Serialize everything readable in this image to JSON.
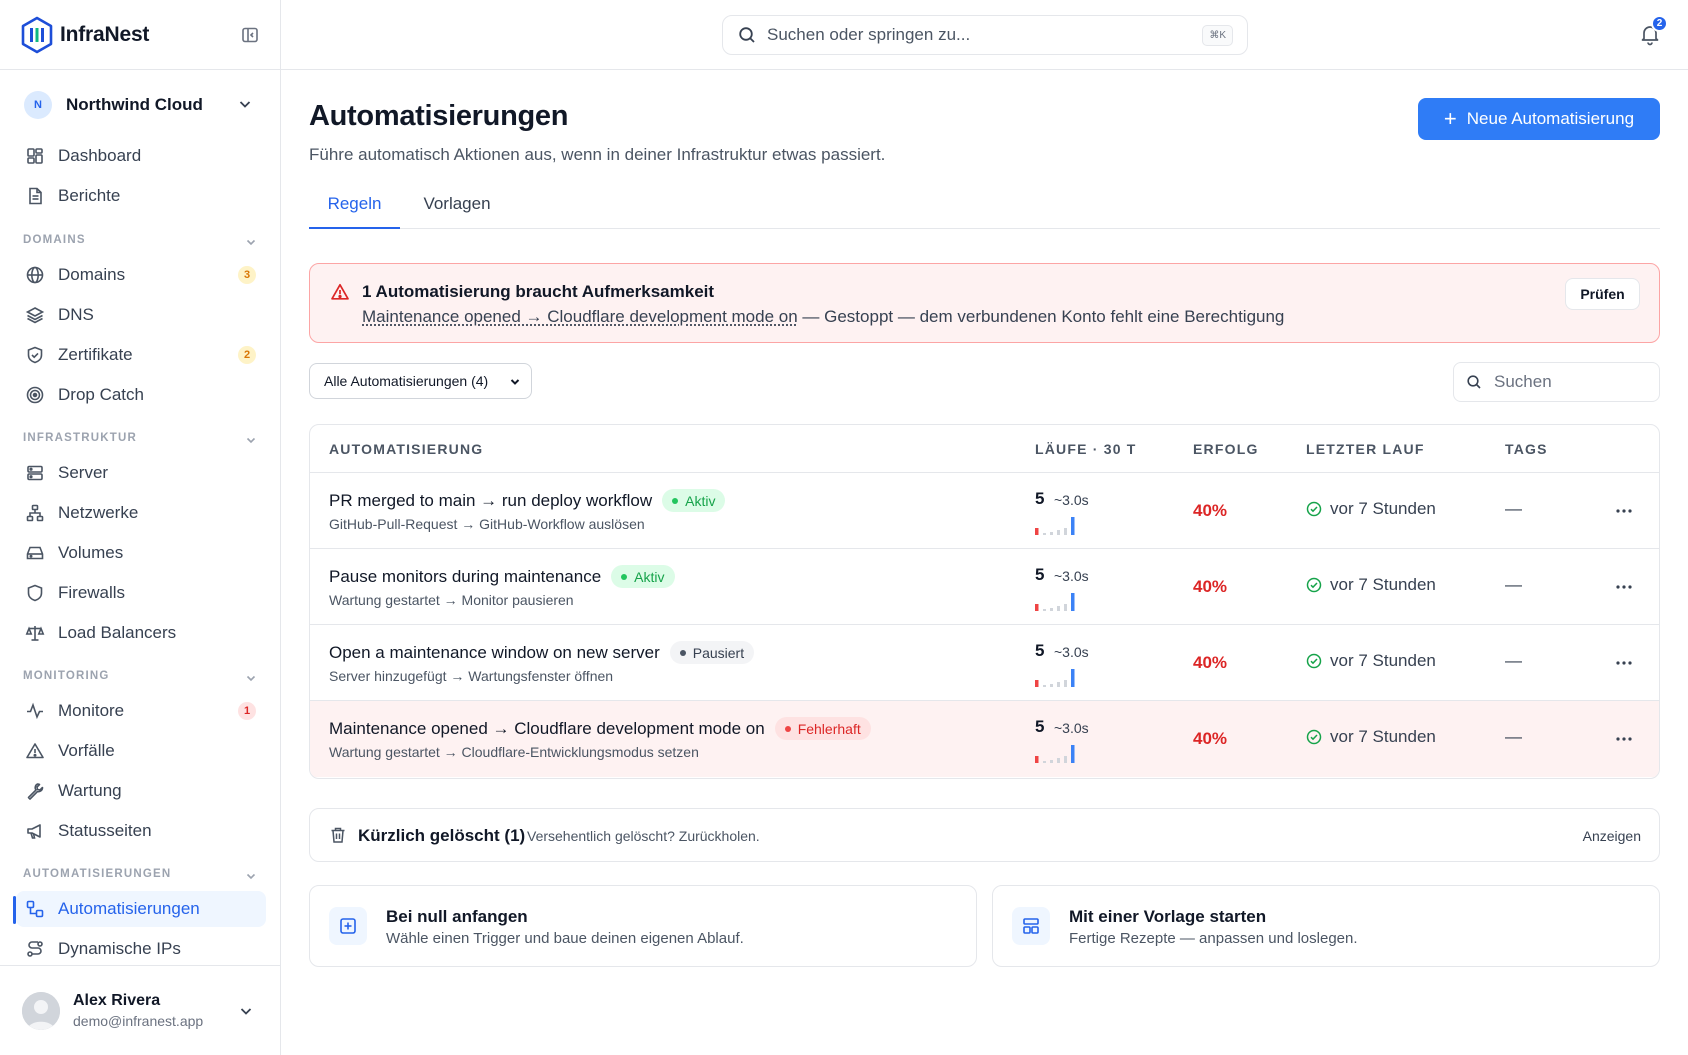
{
  "app": {
    "name": "InfraNest"
  },
  "org": {
    "initial": "N",
    "name": "Northwind Cloud"
  },
  "sidebar": {
    "top_items": [
      {
        "label": "Dashboard"
      },
      {
        "label": "Berichte"
      }
    ],
    "sections": {
      "domains": "DOMAINS",
      "infrastruktur": "INFRASTRUKTUR",
      "monitoring": "MONITORING",
      "automatisierungen": "AUTOMATISIERUNGEN"
    },
    "domains_items": [
      {
        "label": "Domains",
        "count": "3"
      },
      {
        "label": "DNS"
      },
      {
        "label": "Zertifikate",
        "count": "2"
      },
      {
        "label": "Drop Catch"
      }
    ],
    "infra_items": [
      {
        "label": "Server"
      },
      {
        "label": "Netzwerke"
      },
      {
        "label": "Volumes"
      },
      {
        "label": "Firewalls"
      },
      {
        "label": "Load Balancers"
      }
    ],
    "monitoring_items": [
      {
        "label": "Monitore",
        "count": "1"
      },
      {
        "label": "Vorfälle"
      },
      {
        "label": "Wartung"
      },
      {
        "label": "Statusseiten"
      }
    ],
    "automation_items": [
      {
        "label": "Automatisierungen",
        "active": true
      },
      {
        "label": "Dynamische IPs"
      }
    ],
    "user": {
      "name": "Alex Rivera",
      "email": "demo@infranest.app"
    }
  },
  "topbar": {
    "search_placeholder": "Suchen oder springen zu...",
    "shortcut": "⌘K",
    "notification_count": "2"
  },
  "page": {
    "title": "Automatisierungen",
    "subtitle": "Führe automatisch Aktionen aus, wenn in deiner Infrastruktur etwas passiert.",
    "new_button": "Neue Automatisierung",
    "tabs": [
      {
        "label": "Regeln",
        "active": true
      },
      {
        "label": "Vorlagen"
      }
    ]
  },
  "alert": {
    "title": "1 Automatisierung braucht Aufmerksamkeit",
    "link": "Maintenance opened → Cloudflare development mode on",
    "message": " — Gestoppt — dem verbundenen Konto fehlt eine Berechtigung",
    "button": "Prüfen"
  },
  "filter": {
    "selected": "Alle Automatisierungen (4)"
  },
  "table_search": {
    "placeholder": "Suchen"
  },
  "table": {
    "headers": {
      "name": "AUTOMATISIERUNG",
      "runs": "LÄUFE · 30 T",
      "success": "ERFOLG",
      "last": "LETZTER LAUF",
      "tags": "TAGS"
    },
    "rows": [
      {
        "name": "PR merged to main → run deploy workflow",
        "status": "Aktiv",
        "desc": "GitHub-Pull-Request → GitHub-Workflow auslösen",
        "runs": "5",
        "duration": "~3.0s",
        "success": "40%",
        "last": "vor 7 Stunden",
        "tags": "—"
      },
      {
        "name": "Pause monitors during maintenance",
        "status": "Aktiv",
        "desc": "Wartung gestartet → Monitor pausieren",
        "runs": "5",
        "duration": "~3.0s",
        "success": "40%",
        "last": "vor 7 Stunden",
        "tags": "—"
      },
      {
        "name": "Open a maintenance window on new server",
        "status": "Pausiert",
        "desc": "Server hinzugefügt → Wartungsfenster öffnen",
        "runs": "5",
        "duration": "~3.0s",
        "success": "40%",
        "last": "vor 7 Stunden",
        "tags": "—"
      },
      {
        "name": "Maintenance opened → Cloudflare development mode on",
        "status": "Fehlerhaft",
        "desc": "Wartung gestartet → Cloudflare-Entwicklungsmodus setzen",
        "runs": "5",
        "duration": "~3.0s",
        "success": "40%",
        "last": "vor 7 Stunden",
        "tags": "—"
      }
    ]
  },
  "deleted": {
    "title": "Kürzlich gelöscht (1)",
    "subtitle": "Versehentlich gelöscht? Zurückholen.",
    "link": "Anzeigen"
  },
  "cards": [
    {
      "title": "Bei null anfangen",
      "subtitle": "Wähle einen Trigger und baue deinen eigenen Ablauf."
    },
    {
      "title": "Mit einer Vorlage starten",
      "subtitle": "Fertige Rezepte — anpassen und loslegen."
    }
  ],
  "colors": {
    "accent": "#2563eb",
    "danger": "#dc2626",
    "success": "#16a34a"
  }
}
